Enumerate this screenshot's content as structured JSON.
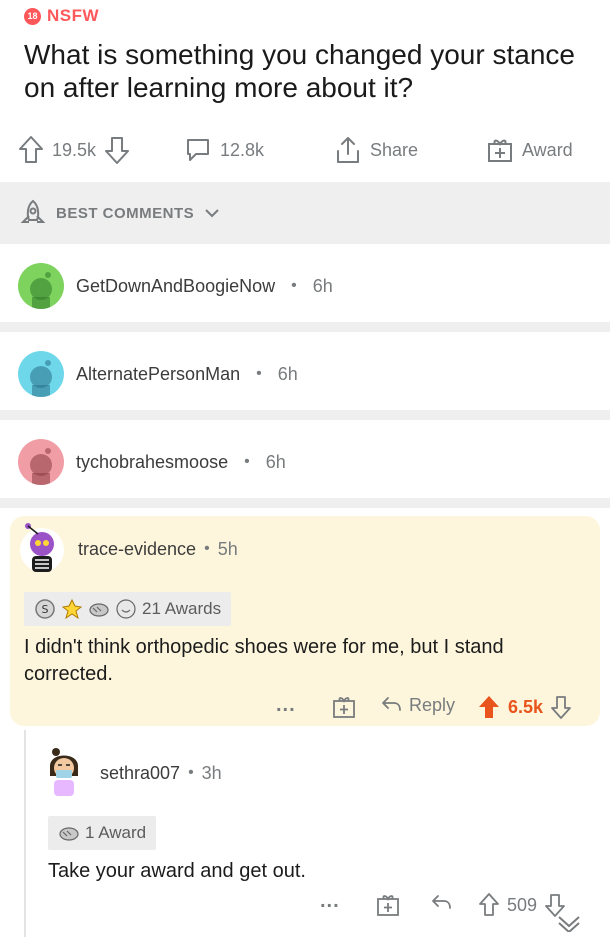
{
  "post": {
    "nsfw_badge": "18",
    "nsfw_label": "NSFW",
    "title": "What is something you changed your stance on after learning more about it?"
  },
  "actions": {
    "upvotes": "19.5k",
    "comments": "12.8k",
    "share": "Share",
    "award": "Award"
  },
  "sort": {
    "label": "BEST COMMENTS"
  },
  "collapsed_comments": [
    {
      "user": "GetDownAndBoogieNow",
      "time": "6h",
      "avatar_color": "#7dd35d"
    },
    {
      "user": "AlternatePersonMan",
      "time": "6h",
      "avatar_color": "#6ed7ea"
    },
    {
      "user": "tychobrahesmoose",
      "time": "6h",
      "avatar_color": "#f19da5"
    }
  ],
  "top_comment": {
    "user": "trace-evidence",
    "time": "5h",
    "awards": "21 Awards",
    "body": "I didn't think orthopedic shoes were for me, but I stand corrected.",
    "reply": "Reply",
    "score": "6.5k"
  },
  "reply_comment": {
    "user": "sethra007",
    "time": "3h",
    "awards": "1 Award",
    "body": "Take your award and get out.",
    "score": "509"
  },
  "separator": "•",
  "more_glyph": "...",
  "colors": {
    "nsfw": "#ff585b",
    "upvote_active": "#e8541c",
    "highlight_bg": "#fdf6dc",
    "muted": "#787c7e"
  }
}
